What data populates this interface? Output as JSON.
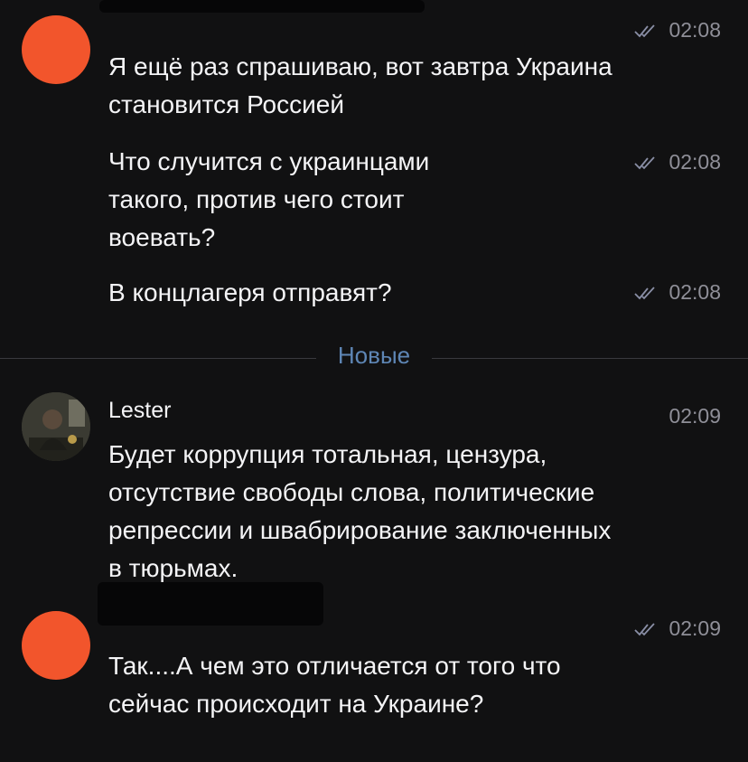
{
  "chat": {
    "divider_label": "Новые",
    "messages": [
      {
        "time": "02:08",
        "lines": [
          "Я ещё раз спрашиваю, вот завтра Украина",
          "становится Россией"
        ]
      },
      {
        "time": "02:08",
        "lines": [
          "Что случится с украинцами",
          "такого, против чего стоит",
          "воевать?"
        ]
      },
      {
        "time": "02:08",
        "lines": [
          "В концлагеря отправят?"
        ]
      },
      {
        "sender": "Lester",
        "time": "02:09",
        "lines": [
          "Будет коррупция тотальная, цензура,",
          "отсутствие свободы слова, политические",
          "репрессии и швабрирование заключенных",
          "в тюрьмах."
        ]
      },
      {
        "time": "02:09",
        "lines": [
          "Так....А чем это отличается от того что",
          "сейчас происходит на Украине?"
        ]
      }
    ]
  },
  "colors": {
    "background": "#111112",
    "avatar_orange": "#f2552c",
    "divider_accent": "#5e86b5",
    "meta_gray": "#8f8f98"
  },
  "icons": {
    "read_receipt": "double-check-icon"
  }
}
